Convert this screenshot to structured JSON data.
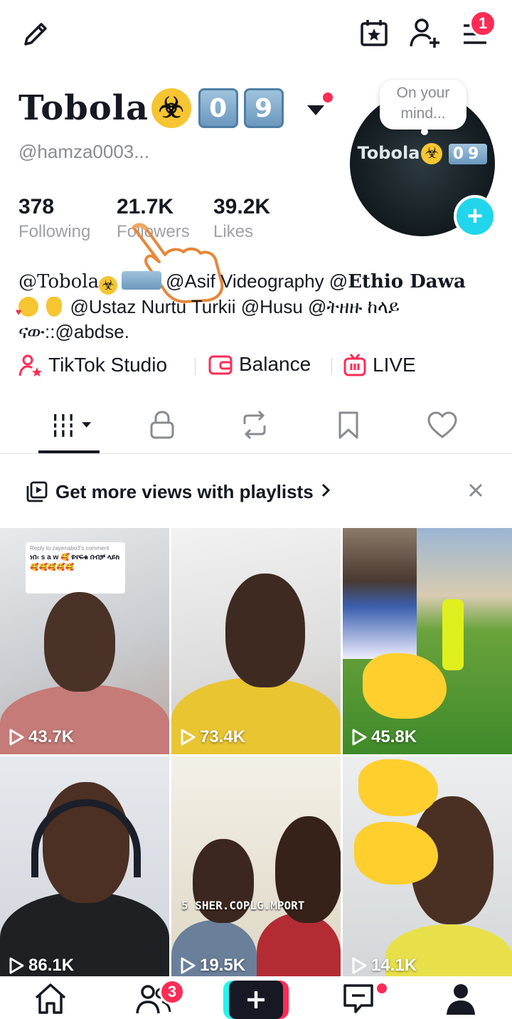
{
  "top_bar": {
    "notification_count": "1"
  },
  "profile": {
    "name": "Tobola",
    "name_keycaps": [
      "0",
      "9"
    ],
    "handle": "@hamza0003...",
    "stats": [
      {
        "value": "378",
        "label": "Following"
      },
      {
        "value": "21.7K",
        "label": "Followers"
      },
      {
        "value": "39.2K",
        "label": "Likes"
      }
    ],
    "avatar_bubble": [
      "On your",
      "mind..."
    ],
    "avatar_text": "Tobola",
    "avatar_keycaps": "09",
    "bio_line1_a": "@Tobola",
    "bio_line1_b": "@Asif Videography @",
    "bio_line1_c": "Ethio Dawa",
    "bio_line2": "@Ustaz Nurtu Turkii @Husu @ትዘዙ ከላይ",
    "bio_line3": "ናው::@abdse."
  },
  "quick_links": {
    "studio": "TikTok Studio",
    "balance": "Balance",
    "live": "LIVE"
  },
  "promo": {
    "text": "Get more views with playlists"
  },
  "videos": [
    {
      "views": "43.7K",
      "overlay_header": "Reply to zayenabo3's comment",
      "overlay_text": "ነበ‹ s a w 🥰 ዩናፍቁ በብቻ ላይክ🥰🥰🥰🥰🥰"
    },
    {
      "views": "73.4K"
    },
    {
      "views": "45.8K"
    },
    {
      "views": "86.1K"
    },
    {
      "views": "19.5K",
      "overlay_text": "5 SHER.COPLG.MPORT"
    },
    {
      "views": "14.1K"
    }
  ],
  "bottom_nav": {
    "friends_count": "3"
  },
  "colors": {
    "accent": "#fe2c55",
    "teal": "#20d5ec",
    "text": "#161823",
    "muted": "#a0a1a6"
  }
}
